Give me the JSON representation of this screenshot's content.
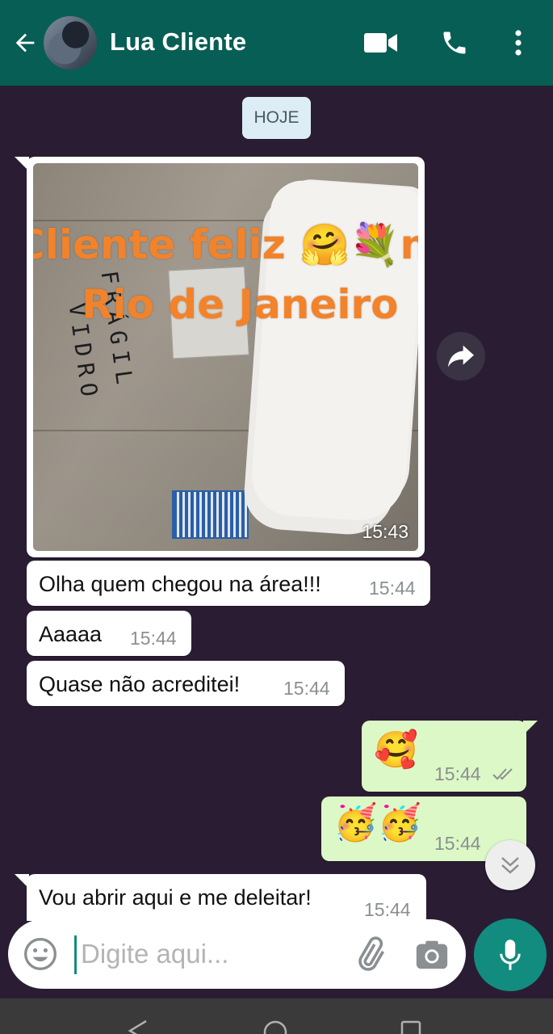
{
  "header": {
    "contact_name": "Lua Cliente"
  },
  "chat": {
    "date_chip": "HOJE",
    "image_message": {
      "overlay_line1": "Cliente feliz 🤗💐no",
      "overlay_line2": "Rio de Janeiro",
      "time": "15:43",
      "handwriting": [
        "FRÁGIL",
        "VIDRO"
      ]
    },
    "messages": [
      {
        "text": "Olha quem chegou na área!!!",
        "time": "15:44",
        "direction": "in"
      },
      {
        "text": "Aaaaa",
        "time": "15:44",
        "direction": "in"
      },
      {
        "text": "Quase não acreditei!",
        "time": "15:44",
        "direction": "in"
      },
      {
        "text": "🥰",
        "time": "15:44",
        "direction": "out"
      },
      {
        "text": "🥳🥳",
        "time": "15:44",
        "direction": "out"
      },
      {
        "text": "Vou abrir aqui e me deleitar!",
        "time": "15:44",
        "direction": "in"
      }
    ]
  },
  "composer": {
    "placeholder": "Digite aqui..."
  },
  "colors": {
    "header": "#075e54",
    "chat_background": "#2a1d33",
    "incoming_bubble": "#ffffff",
    "outgoing_bubble": "#dcf8c6",
    "accent": "#128c7e",
    "overlay_text": "#f2832b"
  },
  "icons": [
    "back-arrow-icon",
    "video-call-icon",
    "phone-icon",
    "more-vert-icon",
    "forward-icon",
    "scroll-down-icon",
    "emoji-icon",
    "attach-icon",
    "camera-icon",
    "mic-icon",
    "nav-back-icon",
    "nav-home-icon",
    "nav-recents-icon"
  ]
}
